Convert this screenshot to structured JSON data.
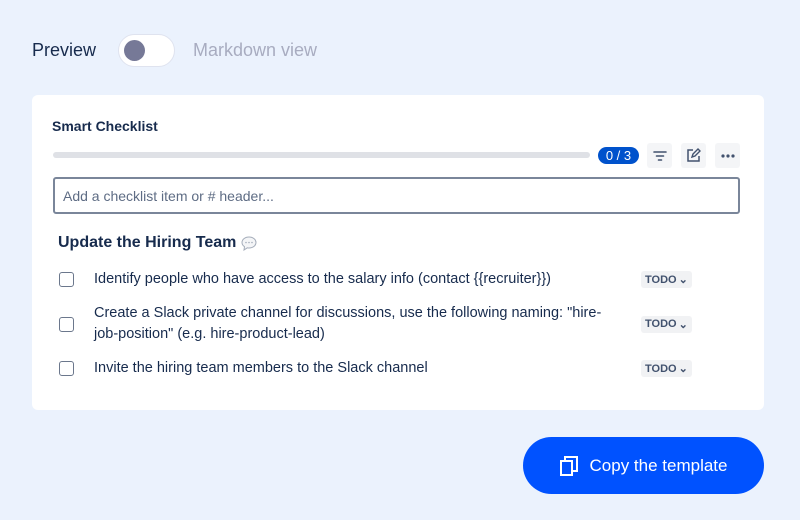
{
  "header": {
    "preview_label": "Preview",
    "toggle_on": false,
    "markdown_label": "Markdown view"
  },
  "checklist": {
    "title": "Smart Checklist",
    "progress": {
      "done": 0,
      "total": 3,
      "label": "0 / 3"
    },
    "input_placeholder": "Add a checklist item or # header...",
    "section_heading": "Update the Hiring Team",
    "items": [
      {
        "text": "Identify people who have access to the salary info (contact {{recruiter}})",
        "status": "TODO",
        "checked": false
      },
      {
        "text": "Create a Slack private channel for discussions, use the following naming: \"hire-job-position\" (e.g. hire-product-lead)",
        "status": "TODO",
        "checked": false
      },
      {
        "text": "Invite the hiring team members to the Slack channel",
        "status": "TODO",
        "checked": false
      }
    ]
  },
  "copy_button": {
    "label": "Copy the template"
  },
  "colors": {
    "accent": "#0052ff",
    "background": "#ebf2fd"
  }
}
